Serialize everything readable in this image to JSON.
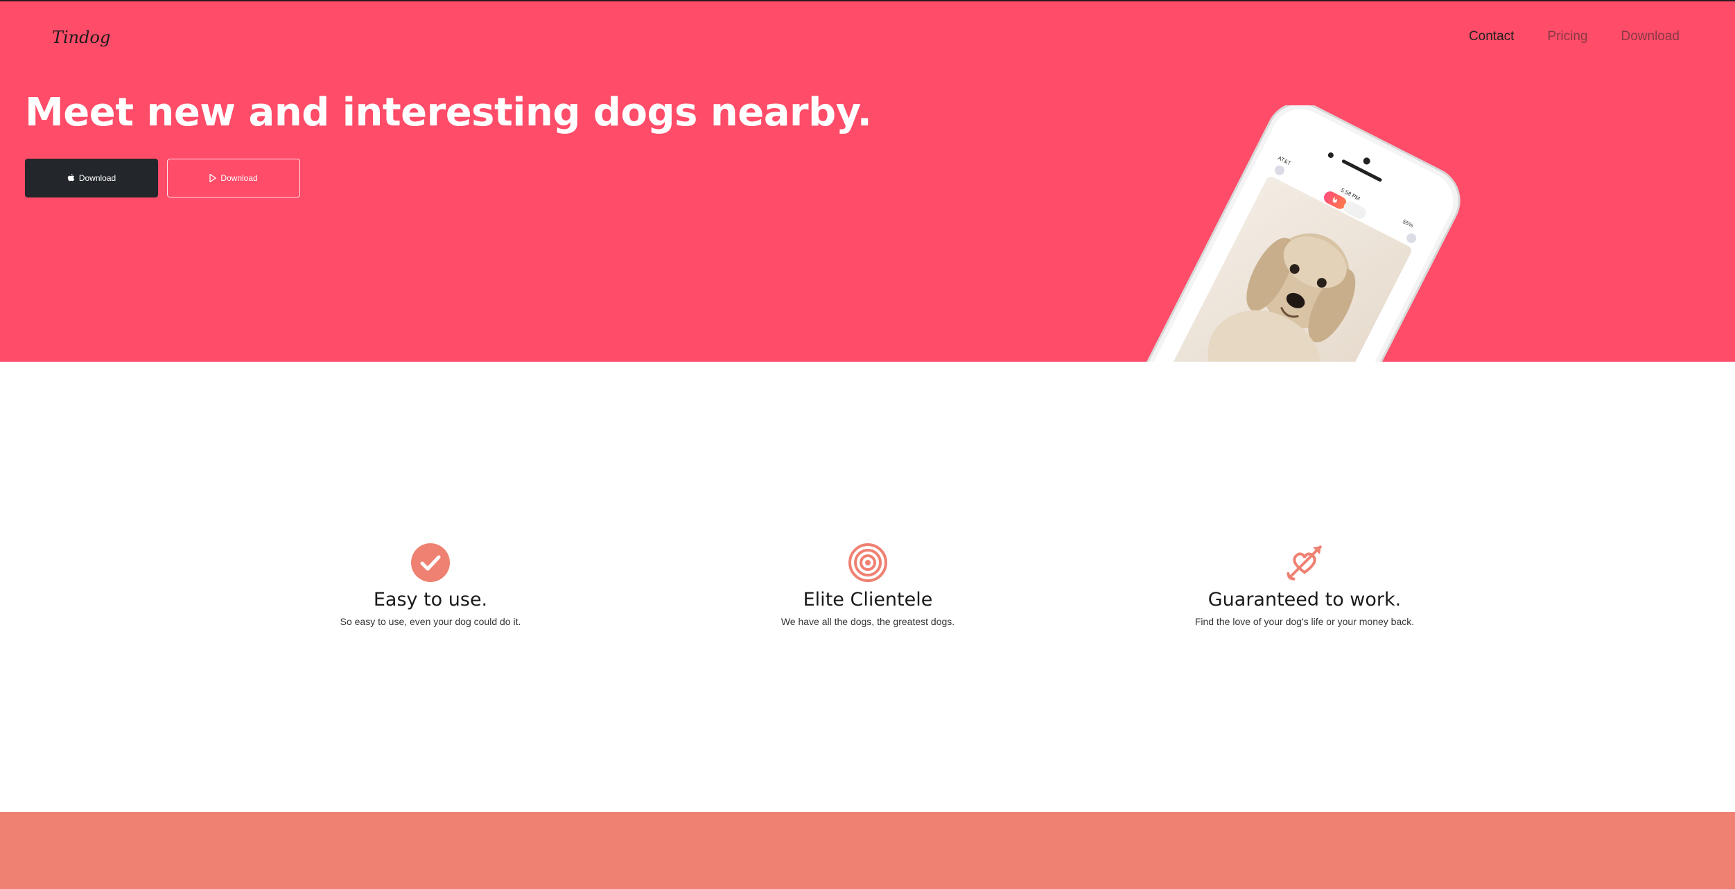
{
  "brand": {
    "name": "Tindog"
  },
  "nav": {
    "items": [
      "Contact",
      "Pricing",
      "Download"
    ]
  },
  "hero": {
    "headline": "Meet new and interesting dogs nearby.",
    "buttons": [
      {
        "label": "Download",
        "icon": "apple-icon"
      },
      {
        "label": "Download",
        "icon": "play-store-icon"
      }
    ]
  },
  "phone": {
    "carrier": "AT&T",
    "time": "5:58 PM",
    "battery": "55%"
  },
  "features": [
    {
      "icon": "check-circle-icon",
      "title": "Easy to use.",
      "text": "So easy to use, even your dog could do it."
    },
    {
      "icon": "bullseye-icon",
      "title": "Elite Clientele",
      "text": "We have all the dogs, the greatest dogs."
    },
    {
      "icon": "heart-arrow-icon",
      "title": "Guaranteed to work.",
      "text": "Find the love of your dog's life or your money back."
    }
  ],
  "colors": {
    "hero_bg": "#ff4c68",
    "accent": "#ef8172",
    "dark_button": "#23272b"
  }
}
